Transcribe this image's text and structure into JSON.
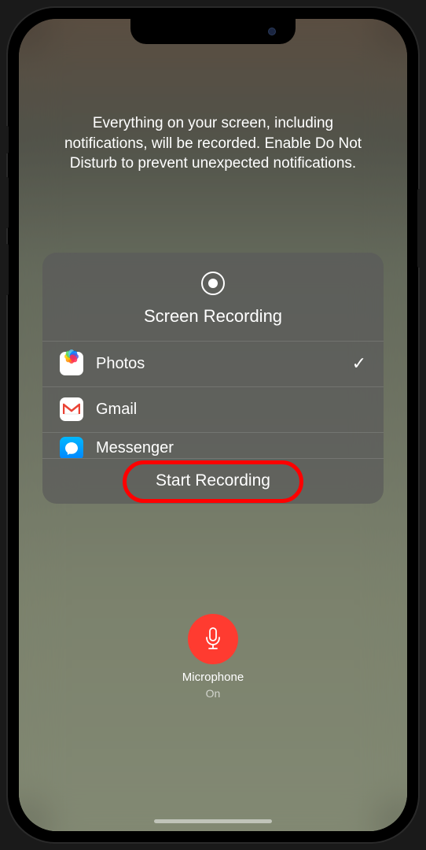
{
  "info_text": "Everything on your screen, including notifications, will be recorded. Enable Do Not Disturb to prevent unexpected notifications.",
  "card": {
    "title": "Screen Recording",
    "apps": [
      {
        "name": "Photos",
        "selected": true
      },
      {
        "name": "Gmail",
        "selected": false
      },
      {
        "name": "Messenger",
        "selected": false
      }
    ],
    "start_label": "Start Recording"
  },
  "microphone": {
    "label": "Microphone",
    "status": "On"
  }
}
